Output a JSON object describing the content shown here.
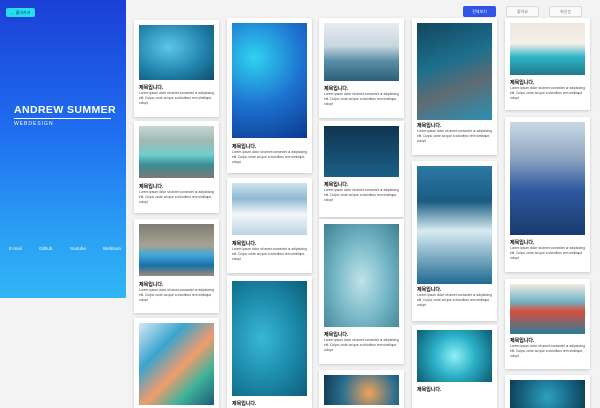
{
  "sidebar": {
    "back_label": "← 돌아가기",
    "name": "ANDREW SUMMER",
    "role": "WEBDESIGN",
    "links": [
      "E-mail",
      "Github",
      "Youtube",
      "Webtoon"
    ]
  },
  "toolbar": {
    "buttons": [
      "전체보기",
      "좋아요",
      "최신순"
    ]
  },
  "cards": {
    "title": "제목입니다.",
    "desc": "Lorem ipsum dolor sit amet consectet ur adipisicing elit. Culpa, unde ad que a doloribus rem similique, volupt"
  }
}
